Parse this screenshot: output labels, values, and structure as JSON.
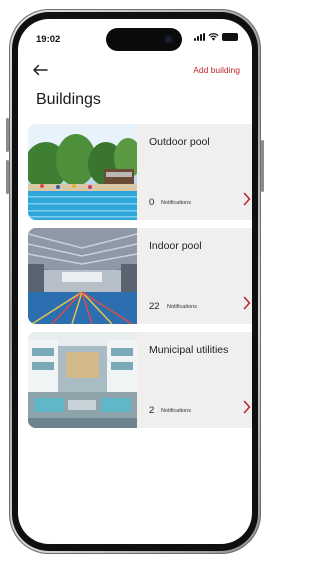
{
  "status_bar": {
    "time": "19:02",
    "icons": [
      "signal-icon",
      "wifi-icon",
      "battery-icon"
    ]
  },
  "header": {
    "back_icon": "arrow-left-icon",
    "add_label": "Add building",
    "title": "Buildings"
  },
  "buildings": [
    {
      "name": "Outdoor pool",
      "count": "0",
      "notifications_label": "Notifications",
      "image": "outdoor-pool-photo"
    },
    {
      "name": "Indoor pool",
      "count": "22",
      "notifications_label": "Notifications",
      "image": "indoor-pool-photo"
    },
    {
      "name": "Municipal utilities",
      "count": "2",
      "notifications_label": "Notifications",
      "image": "municipal-building-photo"
    }
  ],
  "colors": {
    "accent": "#c0262d",
    "card_bg": "#f1eeee",
    "text": "#1a1a1a"
  }
}
